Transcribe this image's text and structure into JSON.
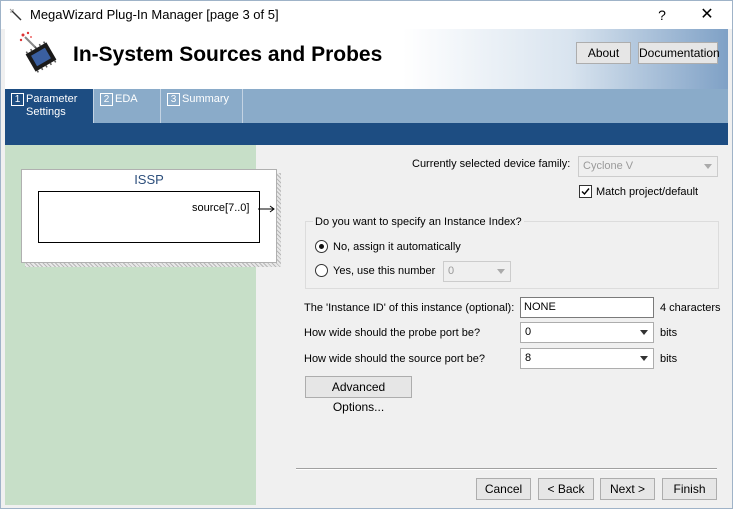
{
  "window": {
    "title": "MegaWizard Plug-In Manager [page 3 of 5]",
    "help_label": "?",
    "close_label": "✕"
  },
  "header": {
    "title": "In-System Sources and Probes",
    "about_label": "About",
    "documentation_label": "Documentation"
  },
  "tabs": [
    {
      "num": "1",
      "label_line1": "Parameter",
      "label_line2": "Settings"
    },
    {
      "num": "2",
      "label_line1": "EDA",
      "label_line2": ""
    },
    {
      "num": "3",
      "label_line1": "Summary",
      "label_line2": ""
    }
  ],
  "symbol": {
    "title": "ISSP",
    "port_label": "source[7..0]"
  },
  "form": {
    "device_family_label": "Currently selected device family:",
    "device_family_value": "Cyclone V",
    "match_label": "Match project/default",
    "match_checked": true,
    "instance_index_question": "Do you want to specify an Instance Index?",
    "radio_auto_label": "No, assign it automatically",
    "radio_number_label": "Yes, use this number",
    "instance_number_value": "0",
    "instance_id_label": "The 'Instance ID' of this instance (optional):",
    "instance_id_value": "NONE",
    "instance_id_hint": "4 characters",
    "probe_width_label": "How wide should the probe port be?",
    "probe_width_value": "0",
    "probe_width_unit": "bits",
    "source_width_label": "How wide should the source port be?",
    "source_width_value": "8",
    "source_width_unit": "bits",
    "advanced_label": "Advanced Options..."
  },
  "footer": {
    "cancel_label": "Cancel",
    "back_label": "< Back",
    "next_label": "Next >",
    "finish_label": "Finish"
  }
}
